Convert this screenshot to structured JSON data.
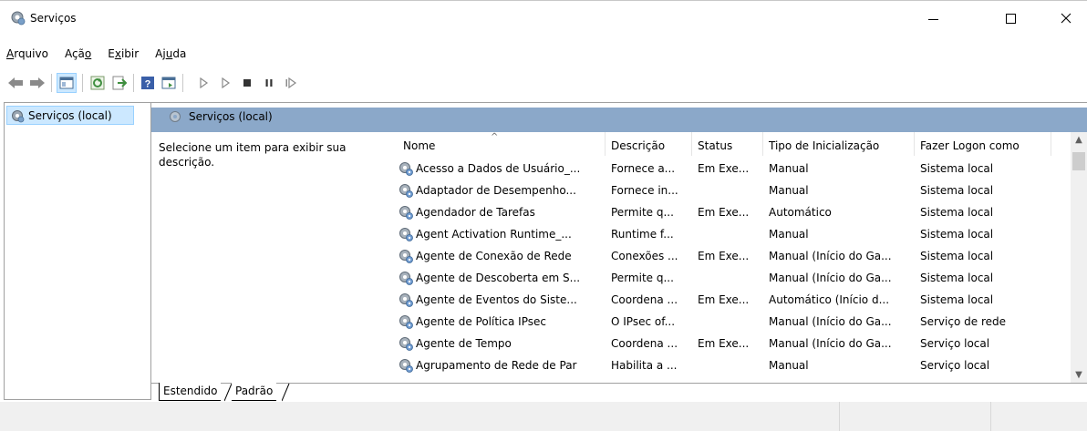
{
  "window": {
    "title": "Serviços",
    "app_icon": "services-gear-icon"
  },
  "menu": [
    {
      "label": "Arquivo",
      "accel": "A",
      "rest": "rquivo",
      "pre": ""
    },
    {
      "label": "Ação",
      "accel": "o",
      "rest": "",
      "pre": "Açã"
    },
    {
      "label": "Exibir",
      "accel": "x",
      "rest": "ibir",
      "pre": "E"
    },
    {
      "label": "Ajuda",
      "accel": "u",
      "rest": "da",
      "pre": "Aj"
    }
  ],
  "tree": {
    "selected_item": "Serviços (local)"
  },
  "panel": {
    "header": "Serviços (local)",
    "description": "Selecione um item para exibir sua descrição."
  },
  "columns": [
    "Nome",
    "Descrição",
    "Status",
    "Tipo de Inicialização",
    "Fazer Logon como"
  ],
  "rows": [
    {
      "name": "Acesso a Dados de Usuário_...",
      "desc": "Fornece a...",
      "status": "Em Exe...",
      "startup": "Manual",
      "logon": "Sistema local"
    },
    {
      "name": "Adaptador de Desempenho...",
      "desc": "Fornece in...",
      "status": "",
      "startup": "Manual",
      "logon": "Sistema local"
    },
    {
      "name": "Agendador de Tarefas",
      "desc": "Permite q...",
      "status": "Em Exe...",
      "startup": "Automático",
      "logon": "Sistema local"
    },
    {
      "name": "Agent Activation Runtime_...",
      "desc": "Runtime f...",
      "status": "",
      "startup": "Manual",
      "logon": "Sistema local"
    },
    {
      "name": "Agente de Conexão de Rede",
      "desc": "Conexões ...",
      "status": "Em Exe...",
      "startup": "Manual (Início do Ga...",
      "logon": "Sistema local"
    },
    {
      "name": "Agente de Descoberta em S...",
      "desc": "Permite q...",
      "status": "",
      "startup": "Manual (Início do Ga...",
      "logon": "Sistema local"
    },
    {
      "name": "Agente de Eventos do Siste...",
      "desc": "Coordena ...",
      "status": "Em Exe...",
      "startup": "Automático (Início d...",
      "logon": "Sistema local"
    },
    {
      "name": "Agente de Política IPsec",
      "desc": "O IPsec of...",
      "status": "",
      "startup": "Manual (Início do Ga...",
      "logon": "Serviço de rede"
    },
    {
      "name": "Agente de Tempo",
      "desc": "Coordena ...",
      "status": "Em Exe...",
      "startup": "Manual (Início do Ga...",
      "logon": "Serviço local"
    },
    {
      "name": "Agrupamento de Rede de Par",
      "desc": "Habilita a ...",
      "status": "",
      "startup": "Manual",
      "logon": "Serviço local"
    }
  ],
  "tabs": [
    "Estendido",
    "Padrão"
  ],
  "colors": {
    "header_band": "#8ba8c9",
    "selection": "#cce8ff"
  }
}
